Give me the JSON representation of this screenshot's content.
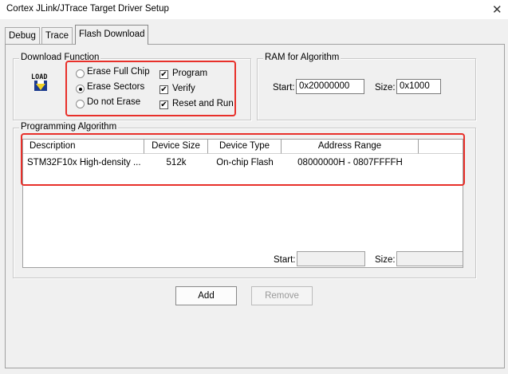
{
  "window": {
    "title": "Cortex JLink/JTrace Target Driver Setup",
    "close_glyph": "✕"
  },
  "tabs": [
    {
      "label": "Debug",
      "active": false
    },
    {
      "label": "Trace",
      "active": false
    },
    {
      "label": "Flash Download",
      "active": true
    }
  ],
  "download_function": {
    "legend": "Download Function",
    "load_icon_label": "LOAD",
    "erase_options": [
      {
        "label": "Erase Full Chip",
        "selected": false
      },
      {
        "label": "Erase Sectors",
        "selected": true
      },
      {
        "label": "Do not Erase",
        "selected": false
      }
    ],
    "checks": [
      {
        "label": "Program",
        "checked": true
      },
      {
        "label": "Verify",
        "checked": true
      },
      {
        "label": "Reset and Run",
        "checked": true
      }
    ]
  },
  "ram": {
    "legend": "RAM for Algorithm",
    "start_label": "Start:",
    "start_value": "0x20000000",
    "size_label": "Size:",
    "size_value": "0x1000"
  },
  "programming": {
    "legend": "Programming Algorithm",
    "columns": [
      "Description",
      "Device Size",
      "Device Type",
      "Address Range"
    ],
    "rows": [
      [
        "STM32F10x High-density ...",
        "512k",
        "On-chip Flash",
        "08000000H - 0807FFFFH"
      ]
    ],
    "start_label": "Start:",
    "start_value": "",
    "size_label": "Size:",
    "size_value": ""
  },
  "buttons": {
    "add": "Add",
    "remove": "Remove"
  },
  "colors": {
    "highlight": "#e8302a",
    "background": "#f0f0f0"
  }
}
